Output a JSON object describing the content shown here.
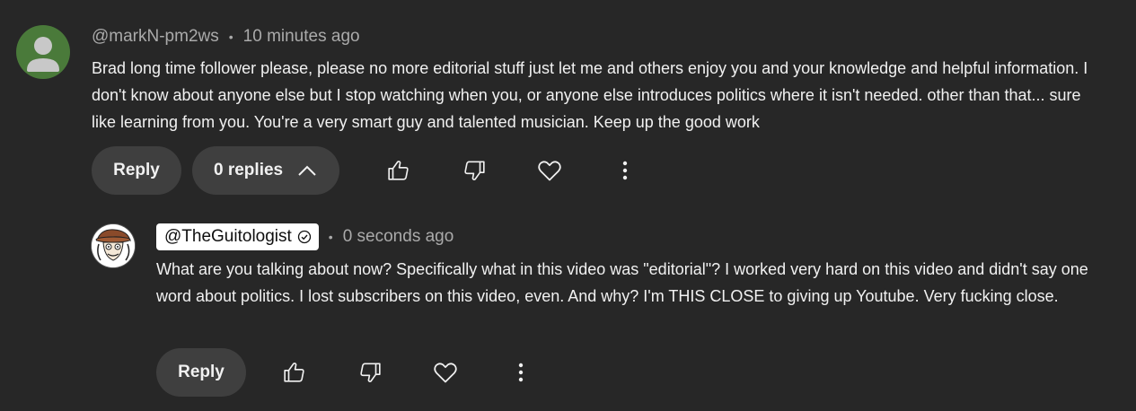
{
  "comment": {
    "author": "@markN-pm2ws",
    "separator": "•",
    "time": "10 minutes ago",
    "text": "Brad long time follower please, please no more editorial stuff just let me and others enjoy you and your knowledge and helpful information. I don't know about anyone else but I stop watching when you, or anyone else introduces politics where it isn't needed. other than that... sure like learning from you. You're a very smart guy and talented musician. Keep up the good work",
    "reply_label": "Reply",
    "replies_label": "0 replies",
    "avatar_icon": "default-user-avatar-icon",
    "avatar_color": "#4a7a3a"
  },
  "reply": {
    "author": "@TheGuitologist",
    "separator": "•",
    "time": "0 seconds ago",
    "text": "What are you talking about now? Specifically what in this video was \"editorial\"? I worked very hard on this video and didn't say one word about politics. I lost subscribers on this video, even. And why? I'm THIS CLOSE to giving up Youtube. Very fucking close.",
    "reply_label": "Reply",
    "avatar_icon": "cartoon-guitarist-avatar-icon",
    "verified_icon": "verified-check-icon"
  },
  "icons": {
    "like": "thumbs-up-icon",
    "dislike": "thumbs-down-icon",
    "heart": "heart-icon",
    "more": "more-vert-icon",
    "collapse": "chevron-up-icon"
  },
  "colors": {
    "background": "#272727",
    "text": "#f1f1f1",
    "meta": "#aaaaaa",
    "button": "#3f3f3f"
  }
}
